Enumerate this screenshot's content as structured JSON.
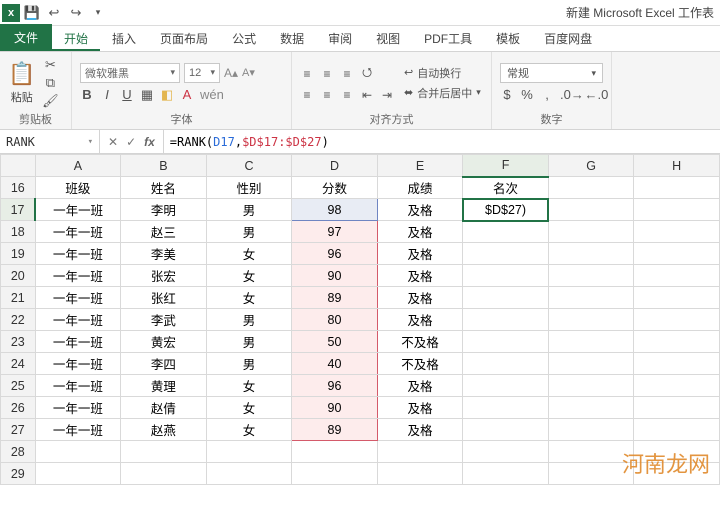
{
  "app": {
    "title": "新建 Microsoft Excel 工作表"
  },
  "tabs": {
    "file": "文件",
    "home": "开始",
    "insert": "插入",
    "layout": "页面布局",
    "formulas": "公式",
    "data": "数据",
    "review": "审阅",
    "view": "视图",
    "pdf": "PDF工具",
    "template": "模板",
    "baidu": "百度网盘"
  },
  "ribbon": {
    "clipboard": {
      "label": "剪贴板",
      "paste": "粘贴"
    },
    "font": {
      "label": "字体",
      "name": "微软雅黑",
      "size": "12",
      "bold": "B",
      "italic": "I",
      "underline": "U"
    },
    "align": {
      "label": "对齐方式",
      "wrap": "自动换行",
      "merge": "合并后居中"
    },
    "number": {
      "label": "数字",
      "format": "常规"
    }
  },
  "namebox": "RANK",
  "formula": {
    "prefix": "=RANK(",
    "arg1": "D17",
    "sep": ",",
    "arg2": "$D$17:$D$27",
    "suffix": ")"
  },
  "columns": [
    "A",
    "B",
    "C",
    "D",
    "E",
    "F",
    "G",
    "H"
  ],
  "header_row_index": "16",
  "headers": {
    "A": "班级",
    "B": "姓名",
    "C": "性别",
    "D": "分数",
    "E": "成绩",
    "F": "名次"
  },
  "active_cell_display": "$D$27)",
  "rows": [
    {
      "n": "17",
      "A": "一年一班",
      "B": "李明",
      "C": "男",
      "D": "98",
      "E": "及格"
    },
    {
      "n": "18",
      "A": "一年一班",
      "B": "赵三",
      "C": "男",
      "D": "97",
      "E": "及格"
    },
    {
      "n": "19",
      "A": "一年一班",
      "B": "李美",
      "C": "女",
      "D": "96",
      "E": "及格"
    },
    {
      "n": "20",
      "A": "一年一班",
      "B": "张宏",
      "C": "女",
      "D": "90",
      "E": "及格"
    },
    {
      "n": "21",
      "A": "一年一班",
      "B": "张红",
      "C": "女",
      "D": "89",
      "E": "及格"
    },
    {
      "n": "22",
      "A": "一年一班",
      "B": "李武",
      "C": "男",
      "D": "80",
      "E": "及格"
    },
    {
      "n": "23",
      "A": "一年一班",
      "B": "黄宏",
      "C": "男",
      "D": "50",
      "E": "不及格"
    },
    {
      "n": "24",
      "A": "一年一班",
      "B": "李四",
      "C": "男",
      "D": "40",
      "E": "不及格"
    },
    {
      "n": "25",
      "A": "一年一班",
      "B": "黄理",
      "C": "女",
      "D": "96",
      "E": "及格"
    },
    {
      "n": "26",
      "A": "一年一班",
      "B": "赵倩",
      "C": "女",
      "D": "90",
      "E": "及格"
    },
    {
      "n": "27",
      "A": "一年一班",
      "B": "赵燕",
      "C": "女",
      "D": "89",
      "E": "及格"
    }
  ],
  "empty_rows": [
    "28",
    "29"
  ],
  "watermark": "河南龙网"
}
